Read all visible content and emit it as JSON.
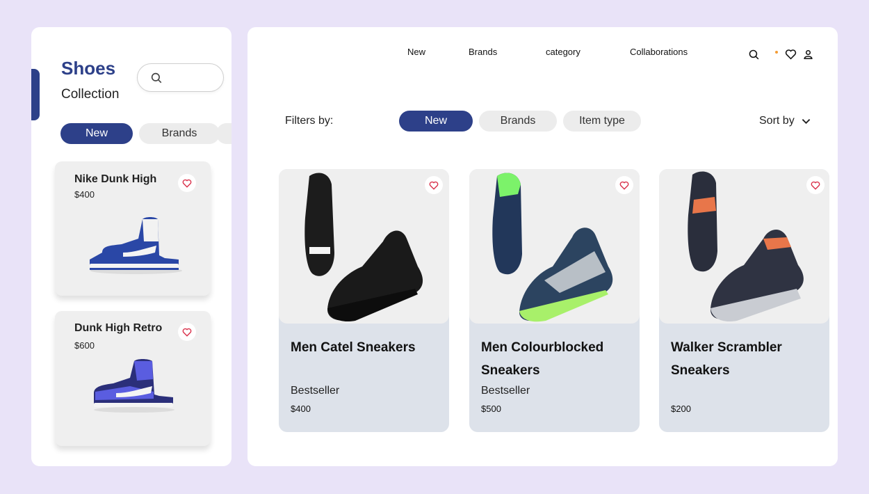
{
  "sidebar": {
    "title": "Shoes",
    "subtitle": "Collection",
    "search": {
      "placeholder": ""
    },
    "chips": [
      {
        "label": "New",
        "active": true
      },
      {
        "label": "Brands",
        "active": false
      },
      {
        "label": "",
        "active": false
      }
    ],
    "products": [
      {
        "name": "Nike Dunk High",
        "price": "$400"
      },
      {
        "name": "Dunk High Retro",
        "price": "$600"
      }
    ]
  },
  "nav": {
    "items": [
      "New",
      "Brands",
      "category",
      "Collaborations"
    ],
    "icons": [
      "search-icon",
      "heart-icon",
      "user-icon"
    ]
  },
  "filters": {
    "label": "Filters by:",
    "chips": [
      {
        "label": "New",
        "active": true
      },
      {
        "label": "Brands",
        "active": false
      },
      {
        "label": "Item type",
        "active": false
      }
    ],
    "sort_label": "Sort by"
  },
  "products": [
    {
      "name": "Men Catel Sneakers",
      "tag": "Bestseller",
      "price": "$400"
    },
    {
      "name": "Men Colourblocked Sneakers",
      "tag": "Bestseller",
      "price": "$500"
    },
    {
      "name": "Walker Scrambler Sneakers",
      "tag": "",
      "price": "$200"
    }
  ],
  "colors": {
    "accent": "#2d4089",
    "background": "#e9e3f8",
    "notification_dot": "#f39c34",
    "heart": "#d9304a"
  }
}
